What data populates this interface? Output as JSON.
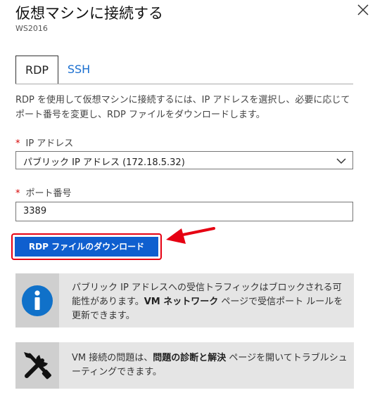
{
  "header": {
    "title": "仮想マシンに接続する",
    "subtitle": "WS2016",
    "close_icon": "close-icon"
  },
  "tabs": [
    {
      "label": "RDP",
      "selected": true
    },
    {
      "label": "SSH",
      "selected": false
    }
  ],
  "description": "RDP を使用して仮想マシンに接続するには、IP アドレスを選択し、必要に応じてポート番号を変更し、RDP ファイルをダウンロードします。",
  "ip_field": {
    "required_mark": "*",
    "label": "IP アドレス",
    "value": "パブリック IP アドレス (172.18.5.32)"
  },
  "port_field": {
    "required_mark": "*",
    "label": "ポート番号",
    "value": "3389"
  },
  "download_button": {
    "label": "RDP ファイルのダウンロード",
    "highlight_color": "#e60012",
    "color": "#0f5fcf"
  },
  "notices": {
    "traffic": {
      "icon": "info-icon",
      "text_before": "パブリック IP アドレスへの受信トラフィックはブロックされる可能性があります。",
      "bold": "VM ネットワーク",
      "text_after": " ページで受信ポート ルールを更新できます。"
    },
    "troubleshoot": {
      "icon": "tools-icon",
      "text_before": "VM 接続の問題は、",
      "bold": "問題の診断と解決",
      "text_after": " ページを開いてトラブルシューティングできます。"
    }
  },
  "colors": {
    "accent": "#1a6fd0",
    "required": "#d60000",
    "annotation": "#e60012"
  }
}
